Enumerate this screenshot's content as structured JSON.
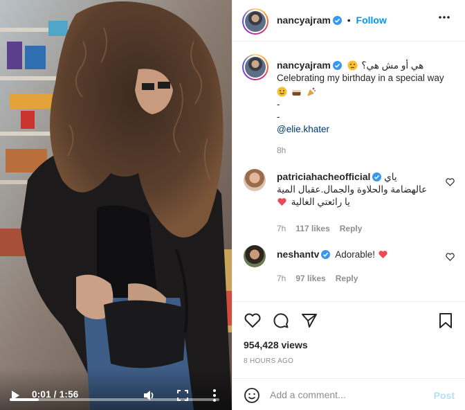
{
  "post": {
    "username": "nancyajram",
    "follow_label": "Follow",
    "caption_arabic": "هي أو مش هي؟",
    "caption_english": "Celebrating my birthday in a special way",
    "caption_emojis": [
      "smiling-face",
      "cake",
      "party-popper"
    ],
    "caption_dash_1": "-",
    "caption_dash_2": "-",
    "caption_mention": "@elie.khater",
    "caption_time": "8h"
  },
  "comments": [
    {
      "username": "patriciahacheofficial",
      "text_line1": "ياي",
      "text_line2": "عالهضامة والحلاوة والجمال.عقبال المية",
      "text_line3": "يا رائعتي الغالية",
      "time": "7h",
      "likes": "117 likes",
      "reply_label": "Reply"
    },
    {
      "username": "neshantv",
      "text": "Adorable!",
      "time": "7h",
      "likes": "97 likes",
      "reply_label": "Reply"
    }
  ],
  "video": {
    "current_time": "0:01",
    "separator": " / ",
    "duration": "1:56",
    "progress_fraction": 0.14
  },
  "stats": {
    "views": "954,428 views",
    "posted_ago": "8 HOURS AGO"
  },
  "comment_box": {
    "placeholder": "Add a comment...",
    "post_label": "Post"
  },
  "icons": {
    "header_more": "more-horizontal-icon",
    "like": "heart-outline-icon",
    "comment": "comment-bubble-icon",
    "share": "paper-plane-icon",
    "save": "bookmark-icon",
    "emoji": "smiley-icon",
    "verified": "verified-badge-icon"
  },
  "colors": {
    "accent": "#0095f6",
    "verified": "#3897f0",
    "heart_red": "#ed4956",
    "muted": "#8e8e8e",
    "post_disabled": "#b2dffc"
  }
}
